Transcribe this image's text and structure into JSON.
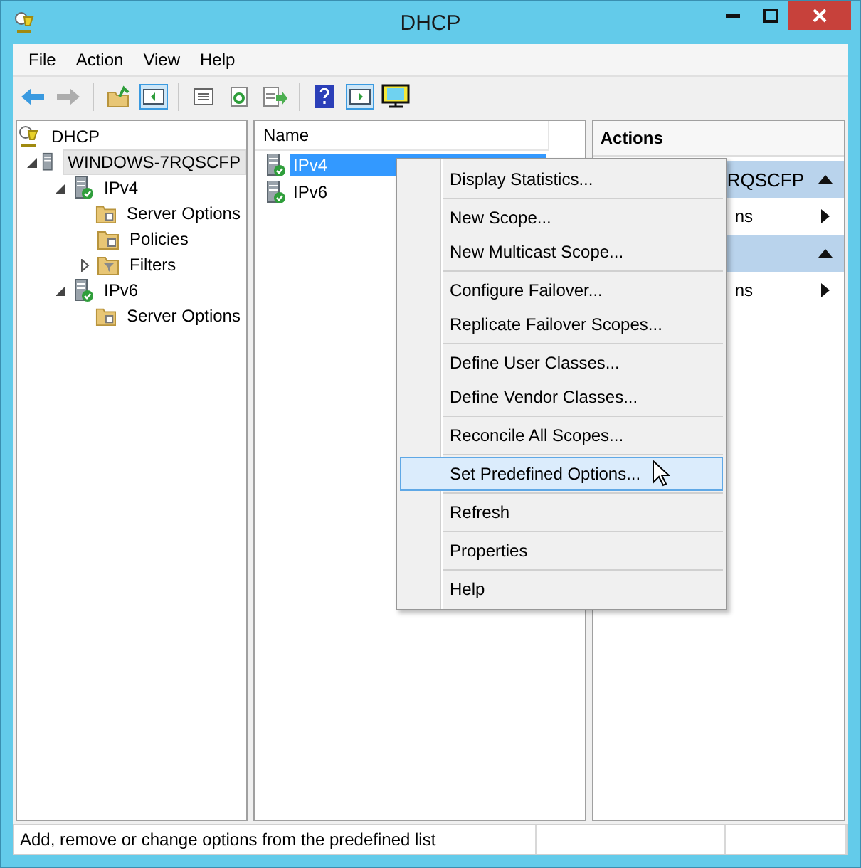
{
  "window": {
    "title": "DHCP"
  },
  "menu_bar": [
    "File",
    "Action",
    "View",
    "Help"
  ],
  "toolbar": [
    {
      "kind": "back",
      "disabled": false
    },
    {
      "kind": "forward",
      "disabled": true
    },
    {
      "kind": "sep"
    },
    {
      "kind": "up",
      "disabled": false
    },
    {
      "kind": "pane",
      "disabled": false
    },
    {
      "kind": "sep"
    },
    {
      "kind": "list",
      "disabled": false
    },
    {
      "kind": "refresh",
      "disabled": false
    },
    {
      "kind": "export",
      "disabled": false
    },
    {
      "kind": "sep"
    },
    {
      "kind": "help",
      "disabled": false
    },
    {
      "kind": "pane2",
      "disabled": false
    },
    {
      "kind": "monitor",
      "disabled": false
    }
  ],
  "tree": [
    {
      "label": "DHCP",
      "kind": "dhcp",
      "selected": false,
      "children": [
        {
          "label": "WINDOWS-7RQSCFP",
          "kind": "server",
          "expanded": true,
          "selected": true,
          "children": [
            {
              "label": "IPv4",
              "kind": "ip",
              "expanded": true,
              "selected": false,
              "children": [
                {
                  "label": "Server Options",
                  "kind": "options",
                  "selected": false
                },
                {
                  "label": "Policies",
                  "kind": "policies",
                  "selected": false
                },
                {
                  "label": "Filters",
                  "kind": "filter",
                  "expanded": false,
                  "selected": false
                }
              ]
            },
            {
              "label": "IPv6",
              "kind": "ip",
              "expanded": true,
              "selected": false,
              "children": [
                {
                  "label": "Server Options",
                  "kind": "options",
                  "selected": false
                }
              ]
            }
          ]
        }
      ]
    }
  ],
  "list": {
    "column": "Name",
    "rows": [
      {
        "label": "IPv4",
        "selected": true
      },
      {
        "label": "IPv6",
        "selected": false
      }
    ]
  },
  "actions": {
    "title": "Actions",
    "sections": [
      {
        "header": "RQSCFP",
        "items": [
          "ns"
        ]
      },
      {
        "items": [
          "ns"
        ]
      }
    ]
  },
  "context_menu": [
    [
      {
        "label": "Display Statistics...",
        "selected": false
      }
    ],
    [
      {
        "label": "New Scope...",
        "selected": false
      },
      {
        "label": "New Multicast Scope...",
        "selected": false
      }
    ],
    [
      {
        "label": "Configure Failover...",
        "selected": false
      },
      {
        "label": "Replicate Failover Scopes...",
        "selected": false
      }
    ],
    [
      {
        "label": "Define User Classes...",
        "selected": false
      },
      {
        "label": "Define Vendor Classes...",
        "selected": false
      }
    ],
    [
      {
        "label": "Reconcile All Scopes...",
        "selected": false
      }
    ],
    [
      {
        "label": "Set Predefined Options...",
        "selected": true
      }
    ],
    [
      {
        "label": "Refresh",
        "selected": false
      }
    ],
    [
      {
        "label": "Properties",
        "selected": false
      }
    ],
    [
      {
        "label": "Help",
        "selected": false
      }
    ]
  ],
  "status_bar": "Add, remove or change options from the predefined list"
}
